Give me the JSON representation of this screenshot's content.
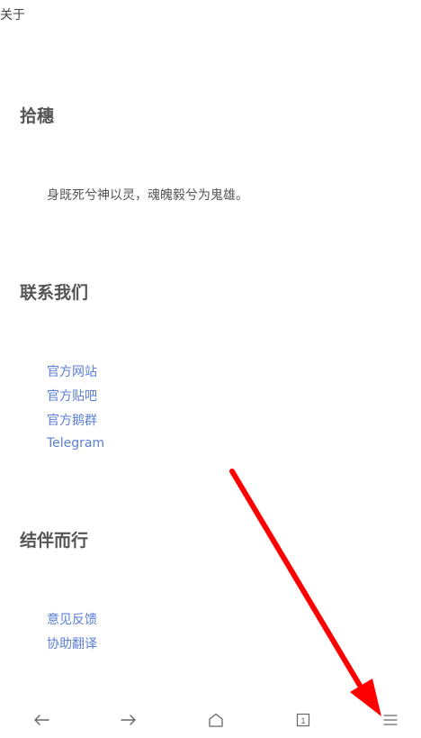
{
  "header": {
    "title": "关于"
  },
  "sections": {
    "shisui": {
      "heading": "拾穗",
      "quote": "身既死兮神以灵，魂魄毅兮为鬼雄。"
    },
    "contact": {
      "heading": "联系我们",
      "links": [
        "官方网站",
        "官方贴吧",
        "官方鹅群",
        "Telegram"
      ]
    },
    "together": {
      "heading": "结伴而行",
      "links": [
        "意见反馈",
        "协助翻译"
      ]
    }
  },
  "bottom_nav": {
    "icons": [
      "back-arrow-icon",
      "forward-arrow-icon",
      "home-icon",
      "tabs-icon",
      "menu-icon"
    ],
    "tab_count": "1"
  },
  "colors": {
    "link": "#5b7fd6",
    "text": "#555555",
    "annotation_arrow": "#ff0000"
  }
}
